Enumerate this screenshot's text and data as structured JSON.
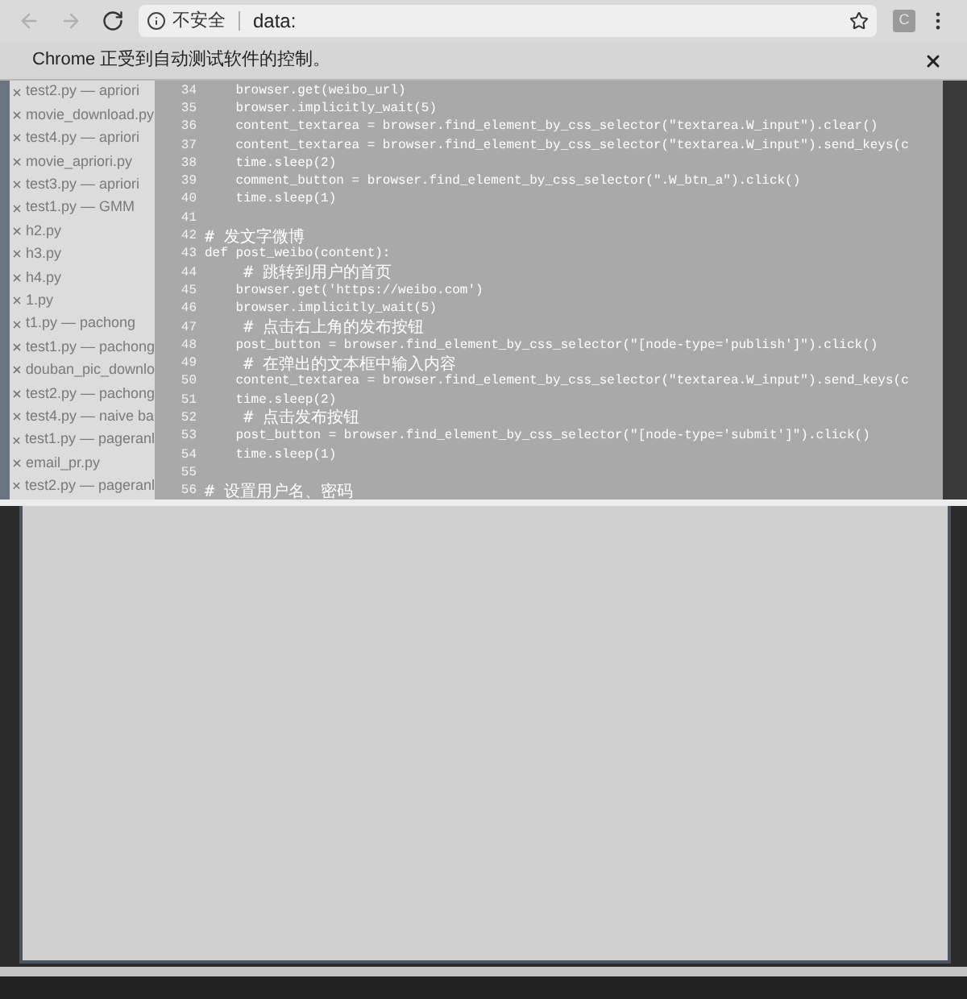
{
  "toolbar": {
    "back": {
      "disabled": true
    },
    "forward": {
      "disabled": true
    },
    "security_label": "不安全",
    "url": "data:",
    "extension_badge": "C"
  },
  "infobar": {
    "message": "Chrome 正受到自动测试软件的控制。"
  },
  "background_editor": {
    "files": [
      {
        "name": "test2.py — apriori"
      },
      {
        "name": "movie_download.py"
      },
      {
        "name": "test4.py — apriori"
      },
      {
        "name": "movie_apriori.py"
      },
      {
        "name": "test3.py — apriori"
      },
      {
        "name": "test1.py — GMM"
      },
      {
        "name": "h2.py"
      },
      {
        "name": "h3.py"
      },
      {
        "name": "h4.py"
      },
      {
        "name": "1.py"
      },
      {
        "name": "t1.py — pachong"
      },
      {
        "name": "test1.py — pachong"
      },
      {
        "name": "douban_pic_downlo"
      },
      {
        "name": "test2.py — pachong"
      },
      {
        "name": "test4.py — naive ba"
      },
      {
        "name": "test1.py — pageranl"
      },
      {
        "name": "email_pr.py"
      },
      {
        "name": "test2.py — pageranl"
      }
    ],
    "code": [
      {
        "line": "34",
        "kind": "code",
        "text": "    browser.get(weibo_url)"
      },
      {
        "line": "35",
        "kind": "code",
        "text": "    browser.implicitly_wait(5)"
      },
      {
        "line": "36",
        "kind": "code",
        "text": "    content_textarea = browser.find_element_by_css_selector(\"textarea.W_input\").clear()"
      },
      {
        "line": "37",
        "kind": "code",
        "text": "    content_textarea = browser.find_element_by_css_selector(\"textarea.W_input\").send_keys(c"
      },
      {
        "line": "38",
        "kind": "code",
        "text": "    time.sleep(2)"
      },
      {
        "line": "39",
        "kind": "code",
        "text": "    comment_button = browser.find_element_by_css_selector(\".W_btn_a\").click()"
      },
      {
        "line": "40",
        "kind": "code",
        "text": "    time.sleep(1)"
      },
      {
        "line": "41",
        "kind": "blank"
      },
      {
        "line": "42",
        "kind": "comment",
        "text": "# 发文字微博"
      },
      {
        "line": "43",
        "kind": "code",
        "text": "def post_weibo(content):"
      },
      {
        "line": "44",
        "kind": "comment",
        "text": "    # 跳转到用户的首页"
      },
      {
        "line": "45",
        "kind": "code",
        "text": "    browser.get('https://weibo.com')"
      },
      {
        "line": "46",
        "kind": "code",
        "text": "    browser.implicitly_wait(5)"
      },
      {
        "line": "47",
        "kind": "comment",
        "text": "    # 点击右上角的发布按钮"
      },
      {
        "line": "48",
        "kind": "code",
        "text": "    post_button = browser.find_element_by_css_selector(\"[node-type='publish']\").click()"
      },
      {
        "line": "49",
        "kind": "comment",
        "text": "    # 在弹出的文本框中输入内容"
      },
      {
        "line": "50",
        "kind": "code",
        "text": "    content_textarea = browser.find_element_by_css_selector(\"textarea.W_input\").send_keys(c"
      },
      {
        "line": "51",
        "kind": "code",
        "text": "    time.sleep(2)"
      },
      {
        "line": "52",
        "kind": "comment",
        "text": "    # 点击发布按钮"
      },
      {
        "line": "53",
        "kind": "code",
        "text": "    post_button = browser.find_element_by_css_selector(\"[node-type='submit']\").click()"
      },
      {
        "line": "54",
        "kind": "code",
        "text": "    time.sleep(1)"
      },
      {
        "line": "55",
        "kind": "blank"
      },
      {
        "line": "56",
        "kind": "comment",
        "text": "# 设置用户名、密码"
      }
    ]
  }
}
